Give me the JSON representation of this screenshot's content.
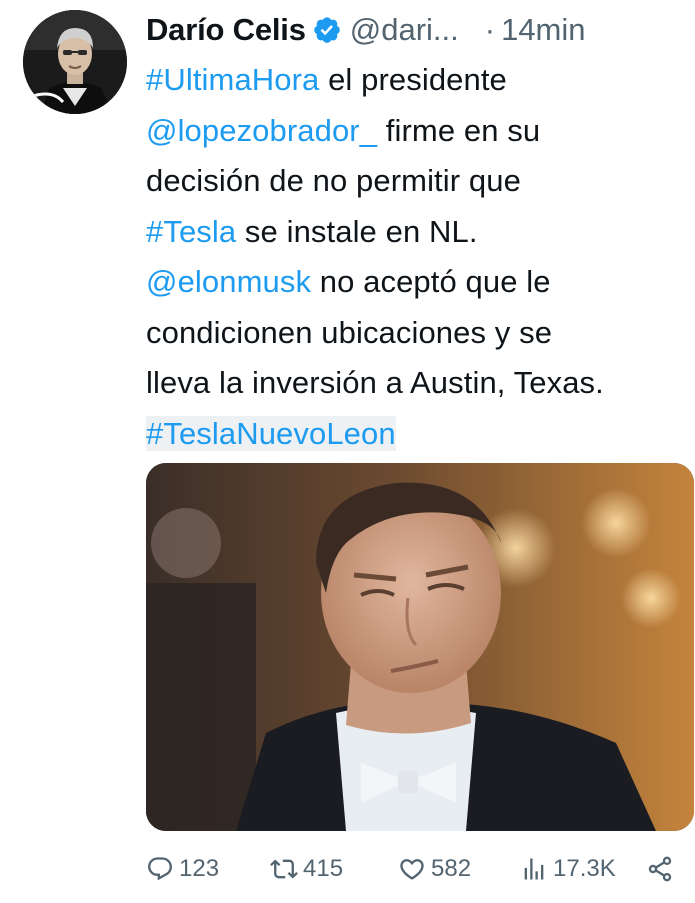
{
  "tweet": {
    "author": {
      "display_name": "Darío Celis",
      "handle": "@dari...",
      "verified": true
    },
    "separator": "·",
    "time": "14min",
    "text": {
      "l1_link": "#UltimaHora",
      "l1_rest": " el presidente",
      "l2_link": "@lopezobrador_",
      "l2_rest": " firme en su",
      "l3": "decisión de no permitir que",
      "l4_link": "#Tesla",
      "l4_rest": " se instale en NL.",
      "l5_link": "@elonmusk",
      "l5_rest": " no aceptó que le",
      "l6": "condicionen ubicaciones y se",
      "l7": "lleva la inversión a Austin, Texas.",
      "l8_link": "#TeslaNuevoLeon"
    },
    "actions": {
      "replies": "123",
      "retweets": "415",
      "likes": "582",
      "views": "17.3K"
    },
    "icons": {
      "reply": "reply-icon",
      "retweet": "retweet-icon",
      "like": "heart-icon",
      "views": "views-icon",
      "share": "share-icon",
      "verified": "verified-badge-icon"
    },
    "colors": {
      "link": "#1d9bf0",
      "muted": "#536471",
      "text": "#0f1419"
    }
  }
}
